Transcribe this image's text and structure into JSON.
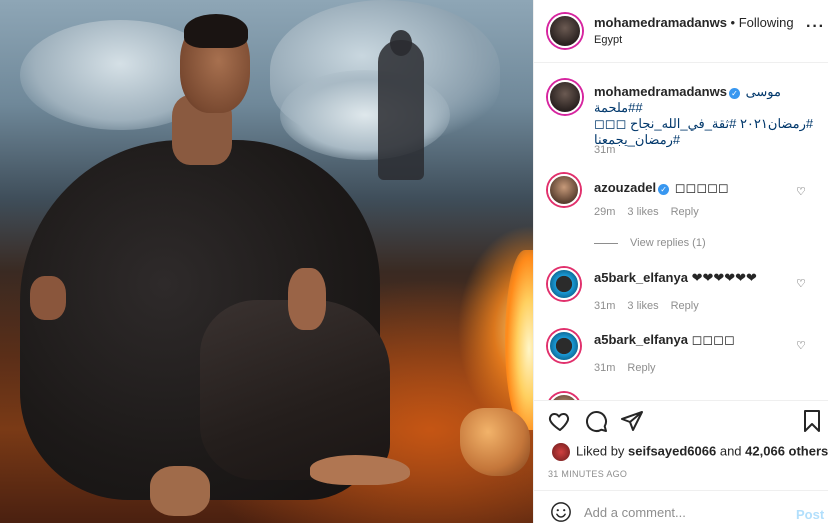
{
  "post": {
    "author": "mohamedramadanws",
    "follow_sep": " • ",
    "follow_label": "Following",
    "location": "Egypt",
    "more_icon": "more-horizontal-icon"
  },
  "caption": {
    "username": "mohamedramadanws",
    "line1": "موسى #ملحمة#",
    "line2": "#رمضان٢٠٢١ #ثقة_في_الله_نجاح ◻◻◻",
    "line3": "#رمضان_يجمعنا",
    "time": "31m"
  },
  "comments": [
    {
      "username": "azouzadel",
      "verified": true,
      "text": "◻◻◻◻◻",
      "time": "29m",
      "likes": "3 likes",
      "reply": "Reply",
      "view_replies": "View replies (1)"
    },
    {
      "username": "a5bark_elfanya",
      "verified": false,
      "text": "❤❤❤❤❤❤",
      "time": "31m",
      "likes": "3 likes",
      "reply": "Reply"
    },
    {
      "username": "a5bark_elfanya",
      "verified": false,
      "text": "◻◻◻◻",
      "time": "31m",
      "likes": "",
      "reply": "Reply"
    }
  ],
  "actions": {
    "likes_prefix": "Liked by ",
    "liked_by_user": "seifsayed6066",
    "likes_mid": " and ",
    "others": "42,066 others",
    "time_ago": "31 MINUTES AGO"
  },
  "add_comment": {
    "placeholder": "Add a comment...",
    "post_label": "Post"
  },
  "colors": {
    "link": "#00376b",
    "verified": "#3897f0",
    "post_disabled": "#b2dffc"
  }
}
